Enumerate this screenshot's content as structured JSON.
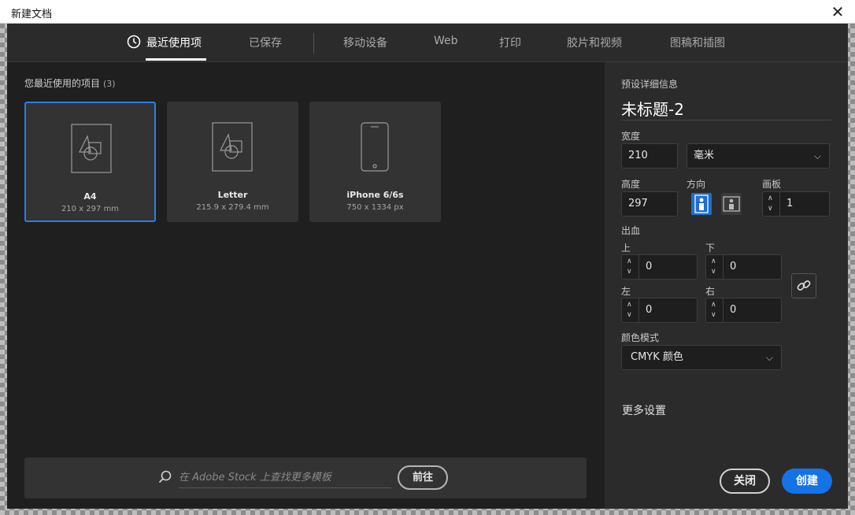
{
  "window": {
    "title": "新建文档",
    "close_glyph": "✕"
  },
  "tabs": [
    {
      "label": "最近使用项",
      "active": true
    },
    {
      "label": "已保存"
    },
    {
      "label": "移动设备"
    },
    {
      "label": "Web"
    },
    {
      "label": "打印"
    },
    {
      "label": "胶片和视频"
    },
    {
      "label": "图稿和插图"
    }
  ],
  "recent": {
    "label": "您最近使用的项目",
    "count": "(3)",
    "items": [
      {
        "name": "A4",
        "size": "210 x 297 mm",
        "icon": "document-shapes-icon",
        "selected": true
      },
      {
        "name": "Letter",
        "size": "215.9 x 279.4 mm",
        "icon": "document-shapes-icon"
      },
      {
        "name": "iPhone 6/6s",
        "size": "750 x 1334 px",
        "icon": "phone-icon"
      }
    ]
  },
  "stock": {
    "placeholder": "在 Adobe Stock 上查找更多模板",
    "go_label": "前往"
  },
  "preset": {
    "section_label": "预设详细信息",
    "doc_title": "未标题-2",
    "width_label": "宽度",
    "width_value": "210",
    "unit_value": "毫米",
    "height_label": "高度",
    "height_value": "297",
    "orientation_label": "方向",
    "artboards_label": "画板",
    "artboards_value": "1",
    "bleed_label": "出血",
    "bleed_top_label": "上",
    "bleed_top_value": "0",
    "bleed_bottom_label": "下",
    "bleed_bottom_value": "0",
    "bleed_left_label": "左",
    "bleed_left_value": "0",
    "bleed_right_label": "右",
    "bleed_right_value": "0",
    "color_mode_label": "颜色模式",
    "color_mode_value": "CMYK 颜色",
    "more_settings": "更多设置",
    "close_label": "关闭",
    "create_label": "创建"
  },
  "colors": {
    "accent": "#1473e6",
    "selected_border": "#2c7be5",
    "panel": "#2b2b2b",
    "bg": "#1f1f1f"
  }
}
